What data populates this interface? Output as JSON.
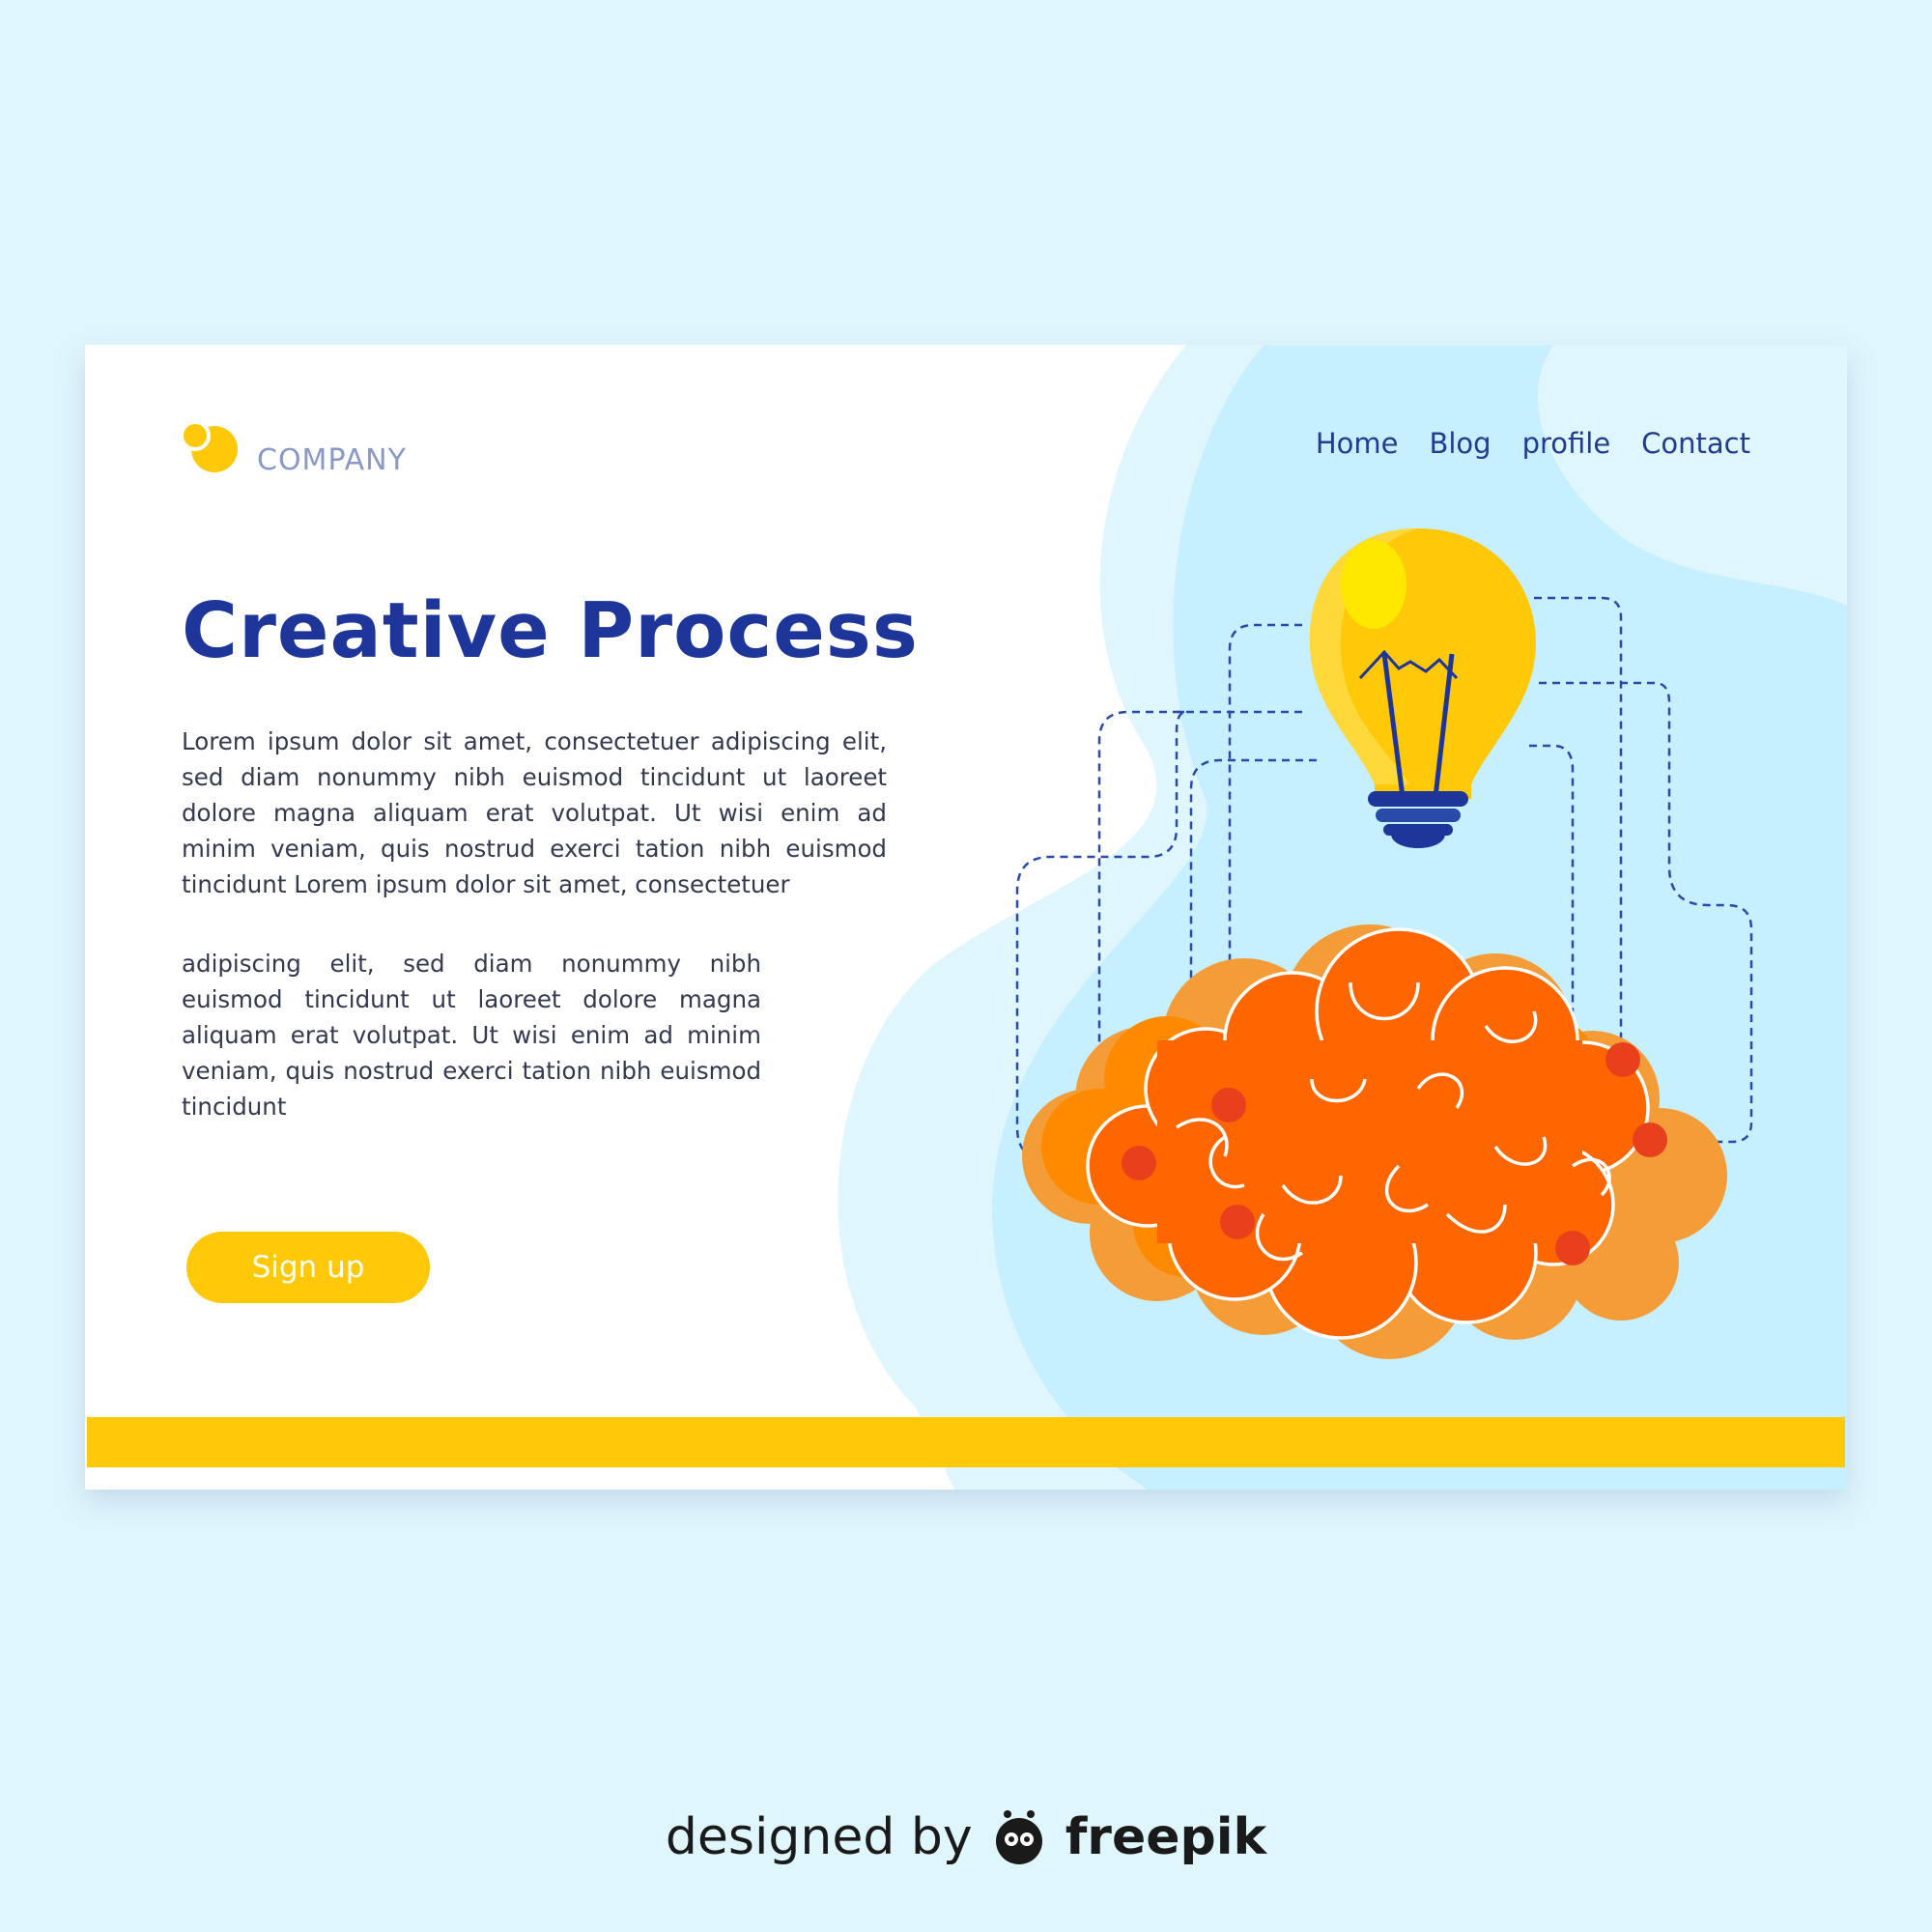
{
  "brand": {
    "name": "COMPANY",
    "logo_icon": "two-yellow-circles-logo",
    "accent_color": "#ffc808",
    "title_color": "#1e3599"
  },
  "nav": {
    "items": [
      {
        "label": "Home"
      },
      {
        "label": "Blog"
      },
      {
        "label": "profile"
      },
      {
        "label": "Contact"
      }
    ]
  },
  "hero": {
    "title": "Creative Process",
    "paragraph1": "Lorem ipsum dolor sit amet, consectetuer adipiscing elit, sed diam nonummy nibh euismod tincidunt ut laoreet dolore magna aliquam erat volutpat. Ut wisi enim ad minim veniam, quis nostrud exerci tation  nibh euismod tincidunt Lorem ipsum dolor sit amet, consectetuer",
    "paragraph2": "adipiscing elit, sed diam nonummy nibh euismod tincidunt ut laoreet dolore magna aliquam erat volutpat. Ut wisi enim ad minim veniam, quis nostrud exerci tation  nibh euismod tincidunt",
    "cta_label": "Sign up"
  },
  "illustration": {
    "icons": [
      "lightbulb-icon",
      "brain-icon"
    ]
  },
  "credit": {
    "prefix": "designed by",
    "brand": "freepik",
    "icon": "freepik-logo-icon"
  }
}
